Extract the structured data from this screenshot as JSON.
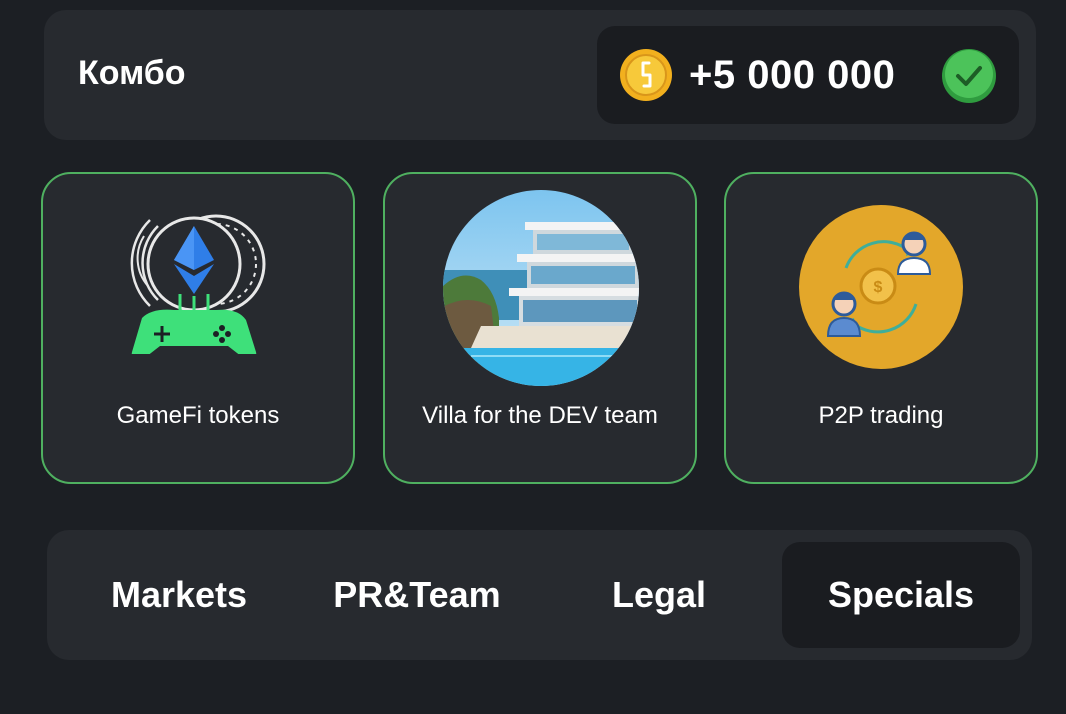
{
  "combo": {
    "title": "Комбо",
    "reward": "+5 000 000",
    "coin_icon": "coin-icon",
    "check_icon": "check-icon",
    "check_color": "#35b24a"
  },
  "cards": [
    {
      "label": "GameFi tokens",
      "icon": "gamefi-gamepad-icon"
    },
    {
      "label": "Villa for the DEV team",
      "icon": "villa-image"
    },
    {
      "label": "P2P trading",
      "icon": "p2p-trading-icon"
    }
  ],
  "tabs": [
    {
      "label": "Markets",
      "selected": false
    },
    {
      "label": "PR&Team",
      "selected": false
    },
    {
      "label": "Legal",
      "selected": false
    },
    {
      "label": "Specials",
      "selected": true
    }
  ],
  "colors": {
    "background": "#1c1f24",
    "panel": "#272a2f",
    "card_border": "#4fb060",
    "accent_green": "#3ee07a",
    "p2p_bg": "#e3a72a"
  }
}
